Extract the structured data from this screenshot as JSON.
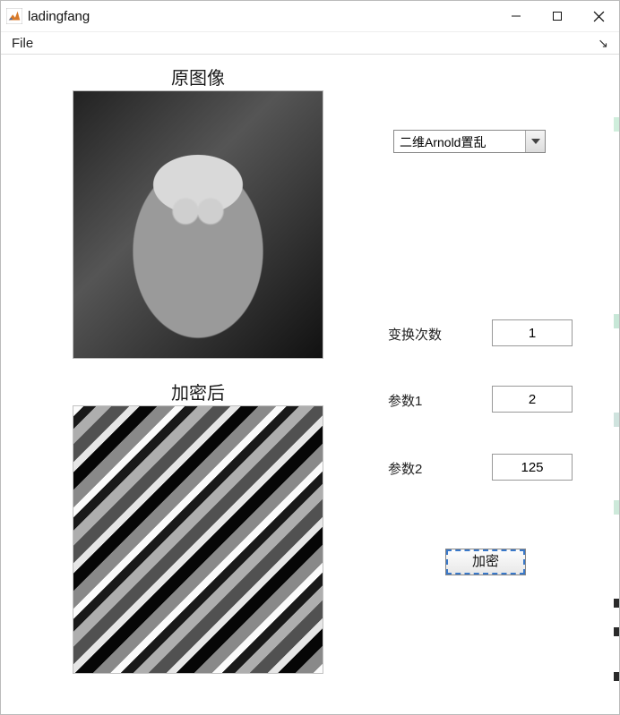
{
  "window": {
    "title": "ladingfang"
  },
  "menubar": {
    "file": "File"
  },
  "sections": {
    "original_title": "原图像",
    "encrypted_title": "加密后"
  },
  "controls": {
    "algorithm_selected": "二维Arnold置乱",
    "iterations_label": "变换次数",
    "iterations_value": "1",
    "param1_label": "参数1",
    "param1_value": "2",
    "param2_label": "参数2",
    "param2_value": "125",
    "encrypt_button": "加密"
  }
}
